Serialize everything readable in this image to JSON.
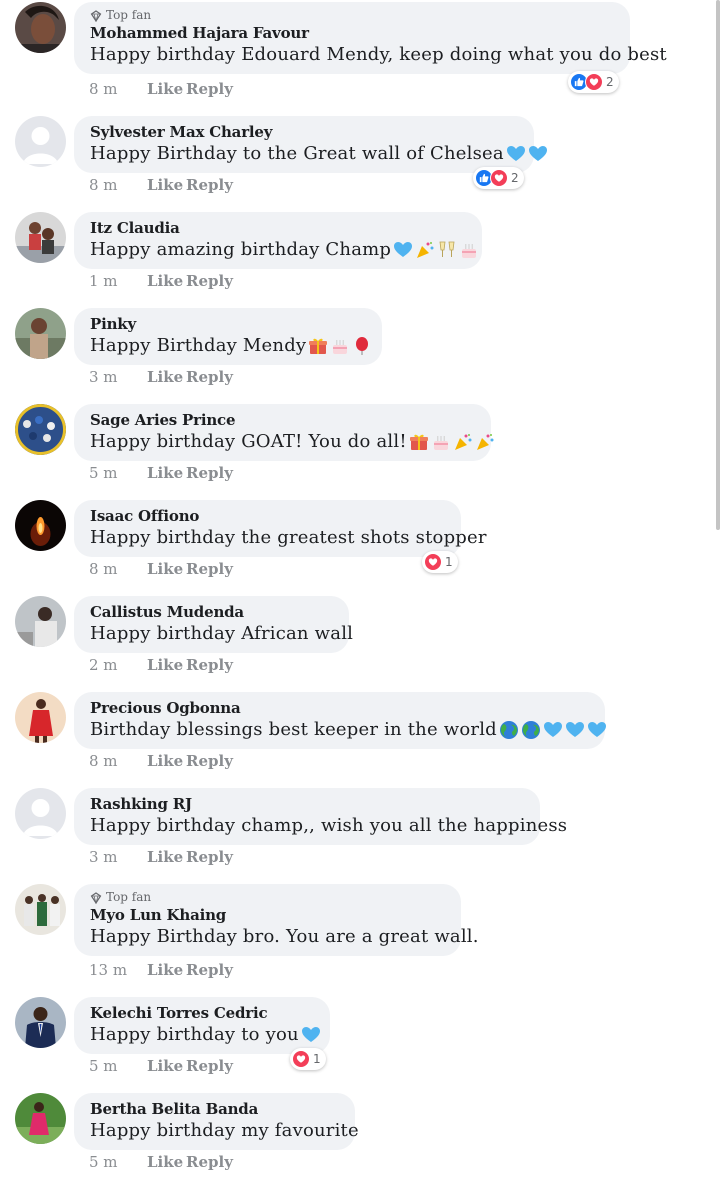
{
  "comments": [
    {
      "badge": "Top fan",
      "author": "Mohammed Hajara Favour",
      "text": "Happy birthday Edouard Mendy, keep doing what you do best",
      "time": "8 m",
      "like": "Like",
      "reply": "Reply",
      "reactions": [
        "like",
        "love"
      ],
      "reaction_count": "2",
      "emojis": [],
      "avatar": "woman-photo"
    },
    {
      "badge": "",
      "author": "Sylvester Max Charley",
      "text": "Happy Birthday to the Great wall of Chelsea",
      "time": "8 m",
      "like": "Like",
      "reply": "Reply",
      "reactions": [
        "like",
        "love"
      ],
      "reaction_count": "2",
      "emojis": [
        "blue-heart",
        "blue-heart"
      ],
      "avatar": "default"
    },
    {
      "badge": "",
      "author": "Itz Claudia",
      "text": "Happy amazing birthday Champ",
      "time": "1 m",
      "like": "Like",
      "reply": "Reply",
      "reactions": [],
      "reaction_count": "",
      "emojis": [
        "blue-heart",
        "party-popper",
        "clinking-glasses",
        "cake"
      ],
      "avatar": "couple-photo"
    },
    {
      "badge": "",
      "author": "Pinky",
      "text": "Happy Birthday  Mendy",
      "time": "3 m",
      "like": "Like",
      "reply": "Reply",
      "reactions": [],
      "reaction_count": "",
      "emojis": [
        "gift",
        "cake",
        "balloon"
      ],
      "avatar": "person-photo"
    },
    {
      "badge": "",
      "author": "Sage Aries Prince",
      "text": "Happy birthday GOAT! You do all!",
      "time": "5 m",
      "like": "Like",
      "reply": "Reply",
      "reactions": [],
      "reaction_count": "",
      "emojis": [
        "gift",
        "cake",
        "party-popper",
        "party-popper"
      ],
      "avatar": "crowd-photo"
    },
    {
      "badge": "",
      "author": "Isaac Offiono",
      "text": "Happy birthday the greatest shots stopper",
      "time": "8 m",
      "like": "Like",
      "reply": "Reply",
      "reactions": [
        "love"
      ],
      "reaction_count": "1",
      "emojis": [],
      "avatar": "candle-photo"
    },
    {
      "badge": "",
      "author": "Callistus Mudenda",
      "text": "Happy birthday African wall",
      "time": "2 m",
      "like": "Like",
      "reply": "Reply",
      "reactions": [],
      "reaction_count": "",
      "emojis": [],
      "avatar": "man-photo"
    },
    {
      "badge": "",
      "author": "Precious Ogbonna",
      "text": "Birthday blessings best keeper in the world",
      "time": "8 m",
      "like": "Like",
      "reply": "Reply",
      "reactions": [],
      "reaction_count": "",
      "emojis": [
        "globe",
        "globe",
        "blue-heart",
        "blue-heart",
        "blue-heart"
      ],
      "avatar": "woman-red-photo"
    },
    {
      "badge": "",
      "author": "Rashking RJ",
      "text": "Happy birthday champ,, wish you all the happiness",
      "time": "3 m",
      "like": "Like",
      "reply": "Reply",
      "reactions": [],
      "reaction_count": "",
      "emojis": [],
      "avatar": "default"
    },
    {
      "badge": "Top fan",
      "author": "Myo Lun Khaing",
      "text": "Happy Birthday bro. You are a great wall.",
      "time": "13 m",
      "like": "Like",
      "reply": "Reply",
      "reactions": [],
      "reaction_count": "",
      "emojis": [],
      "avatar": "group-photo"
    },
    {
      "badge": "",
      "author": "Kelechi Torres Cedric",
      "text": "Happy birthday to you",
      "time": "5 m",
      "like": "Like",
      "reply": "Reply",
      "reactions": [
        "love"
      ],
      "reaction_count": "1",
      "emojis": [
        "blue-heart"
      ],
      "avatar": "man-suit-photo"
    },
    {
      "badge": "",
      "author": "Bertha Belita Banda",
      "text": "Happy birthday my favourite",
      "time": "5 m",
      "like": "Like",
      "reply": "Reply",
      "reactions": [],
      "reaction_count": "",
      "emojis": [],
      "avatar": "woman-garden-photo"
    }
  ],
  "colors": {
    "bubble": "#f0f2f5",
    "like": "#1877f2",
    "love": "#f33e58",
    "meta": "#8a8d91",
    "blue_heart": "#4fb3f0"
  }
}
